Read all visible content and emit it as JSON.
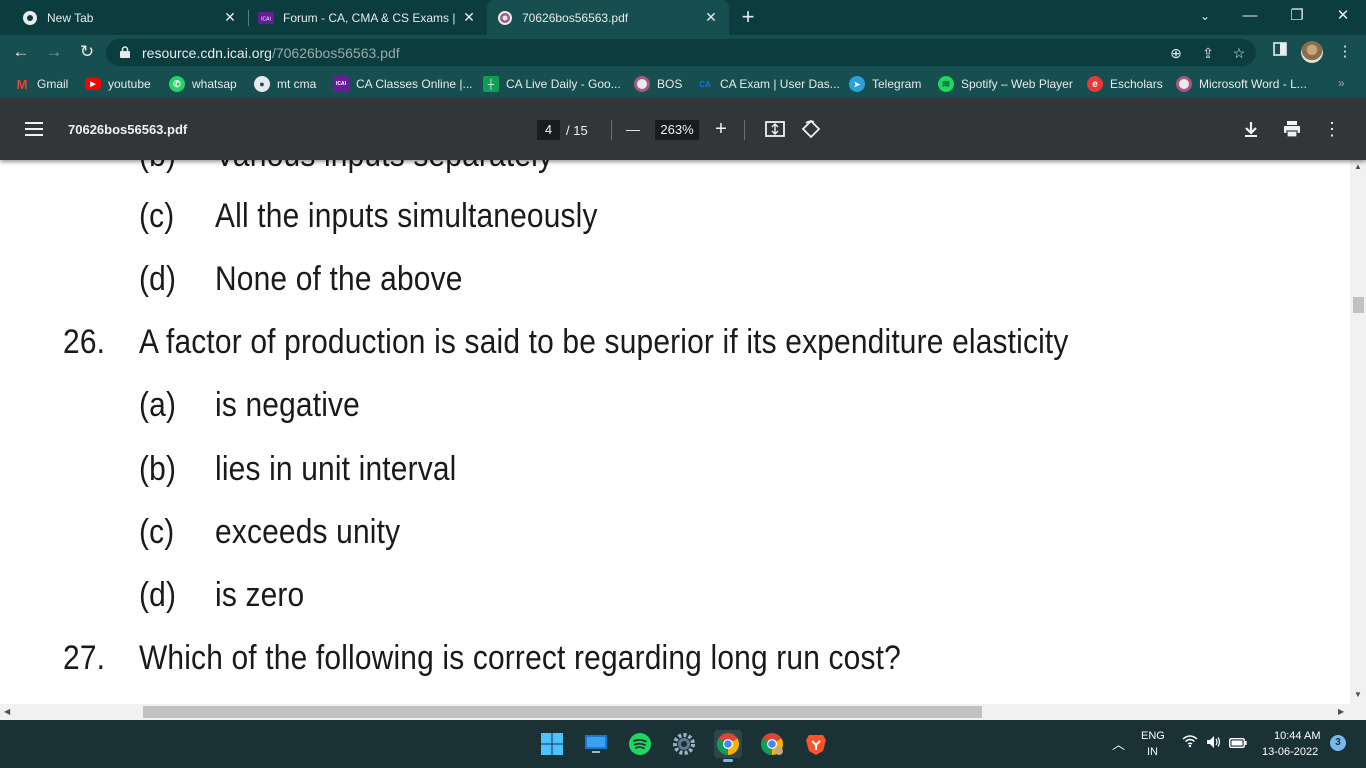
{
  "browser": {
    "tabs": [
      {
        "title": "New Tab",
        "icon": "chrome-icon",
        "active": false
      },
      {
        "title": "Forum - CA, CMA & CS Exams | I",
        "icon": "icai-forum-icon",
        "active": false
      },
      {
        "title": "70626bos56563.pdf",
        "icon": "icai-logo-icon",
        "active": true
      }
    ],
    "new_tab_label": "+",
    "window_controls": {
      "minimize": "—",
      "restore": "❐",
      "close": "✕"
    },
    "address": {
      "domain": "resource.cdn.icai.org",
      "path": "/70626bos56563.pdf"
    },
    "bookmarks": [
      {
        "label": "Gmail",
        "icon": "gmail-icon",
        "color": "#ea4335"
      },
      {
        "label": "youtube",
        "icon": "youtube-icon",
        "color": "#ff0000"
      },
      {
        "label": "whatsap",
        "icon": "whatsapp-icon",
        "color": "#25d366"
      },
      {
        "label": "mt cma",
        "icon": "chrome-icon",
        "color": "#e8eaed"
      },
      {
        "label": "CA Classes Online |...",
        "icon": "icai-forum-icon",
        "color": "#6a1b9a"
      },
      {
        "label": "CA Live Daily - Goo...",
        "icon": "sheets-icon",
        "color": "#0f9d58"
      },
      {
        "label": "BOS",
        "icon": "icai-logo-icon",
        "color": "#a8577e"
      },
      {
        "label": "CA Exam | User Das...",
        "icon": "ca-icon",
        "color": "#1a73e8"
      },
      {
        "label": "Telegram",
        "icon": "telegram-icon",
        "color": "#2aa1da"
      },
      {
        "label": "Spotify – Web Player",
        "icon": "spotify-icon",
        "color": "#1ed760"
      },
      {
        "label": "Escholars",
        "icon": "escholars-icon",
        "color": "#e53935"
      },
      {
        "label": "Microsoft Word - L...",
        "icon": "icai-logo-icon",
        "color": "#a8577e"
      }
    ],
    "bookmarks_more": "»"
  },
  "pdf_viewer": {
    "filename": "70626bos56563.pdf",
    "current_page": "4",
    "page_total": "/ 15",
    "zoom": "263%",
    "zoom_out": "—",
    "zoom_in": "+"
  },
  "document": {
    "partial_line": {
      "label": "(b)",
      "text": "Various inputs separately"
    },
    "options_prev": [
      {
        "label": "(c)",
        "text": "All the inputs simultaneously"
      },
      {
        "label": "(d)",
        "text": "None of the above"
      }
    ],
    "question_26": {
      "number": "26.",
      "text": "A factor of production is said to be superior if its expenditure elasticity",
      "options": [
        {
          "label": "(a)",
          "text": "is negative"
        },
        {
          "label": "(b)",
          "text": "lies in unit interval"
        },
        {
          "label": "(c)",
          "text": "exceeds unity"
        },
        {
          "label": "(d)",
          "text": "is zero"
        }
      ]
    },
    "question_27": {
      "number": "27.",
      "text": "Which of the following is correct regarding long run cost?"
    }
  },
  "taskbar": {
    "apps": [
      "windows-start-icon",
      "desktop-icon",
      "spotify-icon",
      "settings-icon",
      "chrome-icon",
      "chrome-profile-icon",
      "brave-icon"
    ],
    "language": "ENG",
    "region": "IN",
    "time": "10:44 AM",
    "date": "13-06-2022",
    "notifications": "3"
  }
}
